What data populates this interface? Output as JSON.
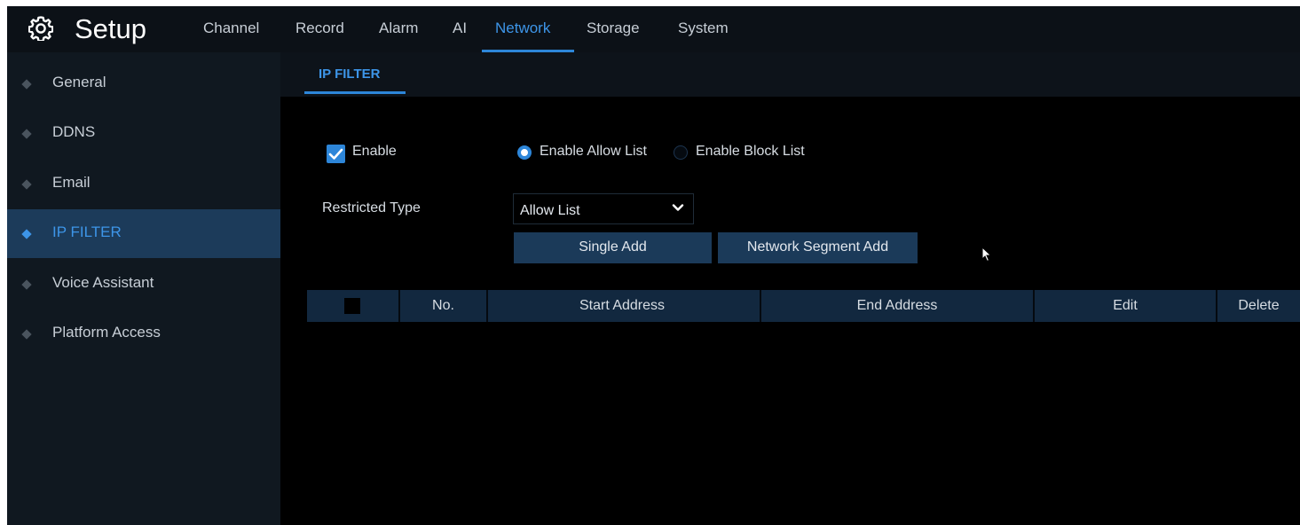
{
  "header": {
    "title": "Setup",
    "tabs": [
      {
        "label": "Channel"
      },
      {
        "label": "Record"
      },
      {
        "label": "Alarm"
      },
      {
        "label": "AI"
      },
      {
        "label": "Network"
      },
      {
        "label": "Storage"
      },
      {
        "label": "System"
      }
    ],
    "active_tab": "Network"
  },
  "sidebar": {
    "items": [
      {
        "label": "General"
      },
      {
        "label": "DDNS"
      },
      {
        "label": "Email"
      },
      {
        "label": "IP FILTER"
      },
      {
        "label": "Voice Assistant"
      },
      {
        "label": "Platform Access"
      }
    ],
    "active_item": "IP FILTER"
  },
  "main": {
    "subtab": "IP FILTER",
    "enable": {
      "label": "Enable",
      "checked": true
    },
    "list_mode": {
      "allow_label": "Enable Allow List",
      "block_label": "Enable Block List",
      "selected": "Enable Allow List"
    },
    "restricted_type": {
      "label": "Restricted Type",
      "value": "Allow List"
    },
    "buttons": {
      "single_add": "Single Add",
      "network_segment_add": "Network Segment Add"
    },
    "table": {
      "columns": [
        "No.",
        "Start Address",
        "End Address",
        "Edit",
        "Delete"
      ],
      "rows": []
    }
  },
  "colors": {
    "accent": "#2d86d9",
    "active_text": "#3d95e8",
    "sidebar_active_bg": "#1c3b5a",
    "button_bg": "#1b3a59",
    "table_header_bg": "#12283f"
  },
  "icons": {
    "title_icon": "gear-icon",
    "select_arrow": "chevron-down-icon",
    "pointer": "mouse-cursor-icon"
  }
}
